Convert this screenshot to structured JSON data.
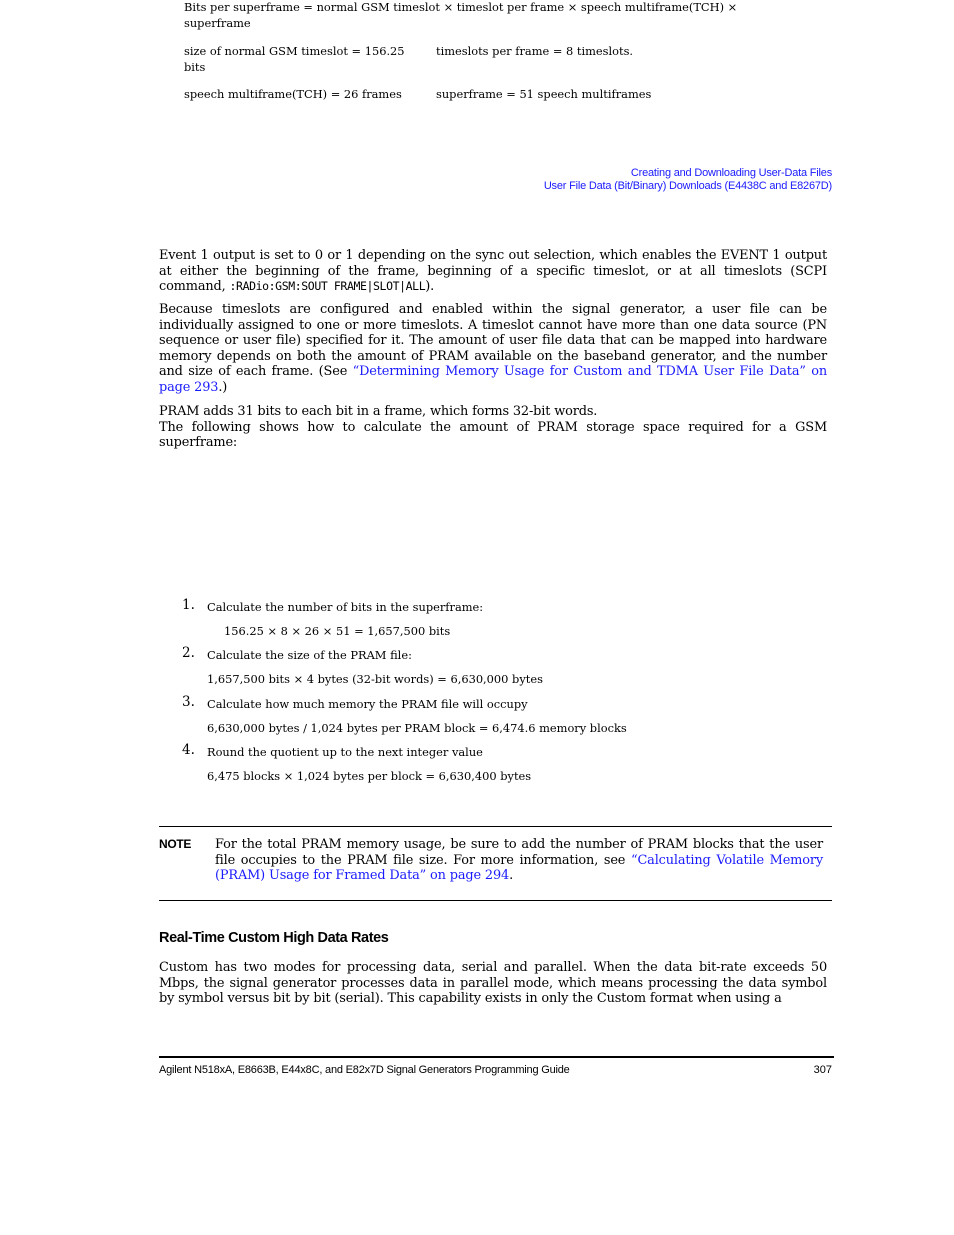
{
  "header": {
    "line1": "Creating and Downloading User-Data Files",
    "line2": "User File Data (Bit/Binary) Downloads (E4438C and E8267D)",
    "link_color": "#1a1aff"
  },
  "paragraphs": {
    "p1": {
      "text_before": "Event 1 output is set to 0 or 1 depending on the sync out selection, which enables the EVENT 1 output at either the beginning of the frame, beginning of a specific timeslot, or at all timeslots (SCPI command, ",
      "code": ":RADio:GSM:SOUT FRAME|SLOT|ALL",
      "text_after": ")."
    },
    "p2": {
      "text_before": "Because timeslots are configured and enabled within the signal generator, a user file can be individually assigned to one or more timeslots. A timeslot cannot have more than one data source (PN sequence or user file) specified for it. The amount of user file data that can be mapped into hardware memory depends on both the amount of PRAM available on the baseband generator, and the number and size of each frame. (See ",
      "link": "“Determining Memory Usage for Custom and TDMA User File Data” on page 293",
      "text_after": ".)"
    },
    "p3": {
      "line1": "PRAM adds 31 bits to each bit in a frame, which forms 32-bit words.",
      "line2": "The following shows how to calculate the amount of PRAM storage space required for a GSM superframe:"
    }
  },
  "formulas": {
    "bits_per_superframe": "Bits per superframe = normal GSM timeslot × timeslot per frame × speech multiframe(TCH) × superframe",
    "timeslot_size": "size of normal GSM timeslot = 156.25 bits",
    "timeslots_per_frame": "timeslots per frame = 8 timeslots.",
    "speech_multiframe": "speech multiframe(TCH) = 26 frames",
    "superframe": "superframe = 51 speech multiframes"
  },
  "steps": [
    {
      "number": "1.",
      "text": "Calculate the number of bits in the superframe:",
      "calc": "156.25 × 8 × 26 × 51 = 1,657,500 bits"
    },
    {
      "number": "2.",
      "text": "Calculate the size of the PRAM file:",
      "calc": "1,657,500 bits × 4 bytes (32-bit words) = 6,630,000 bytes"
    },
    {
      "number": "3.",
      "text": "Calculate how much memory the PRAM file will occupy",
      "calc": "6,630,000 bytes / 1,024 bytes per PRAM block = 6,474.6 memory blocks"
    },
    {
      "number": "4.",
      "text": "Round the quotient up to the next integer value",
      "calc": "6,475 blocks × 1,024 bytes per block = 6,630,400 bytes"
    }
  ],
  "note": {
    "label": "NOTE",
    "text_before": "For the total PRAM memory usage, be sure to add the number of PRAM blocks that the user file occupies to the PRAM file size. For more information, see ",
    "link": "“Calculating Volatile Memory (PRAM) Usage for Framed Data” on page 294",
    "text_after": "."
  },
  "section": {
    "heading": "Real-Time Custom High Data Rates",
    "paragraph": "Custom has two modes for processing data, serial and parallel. When the data bit-rate exceeds 50 Mbps, the signal generator processes data in parallel mode, which means processing the data symbol by symbol versus bit by bit (serial). This capability exists in only the Custom format when using a"
  },
  "footer": {
    "title": "Agilent N518xA, E8663B, E44x8C, and E82x7D Signal Generators Programming Guide",
    "page_number": "307"
  }
}
